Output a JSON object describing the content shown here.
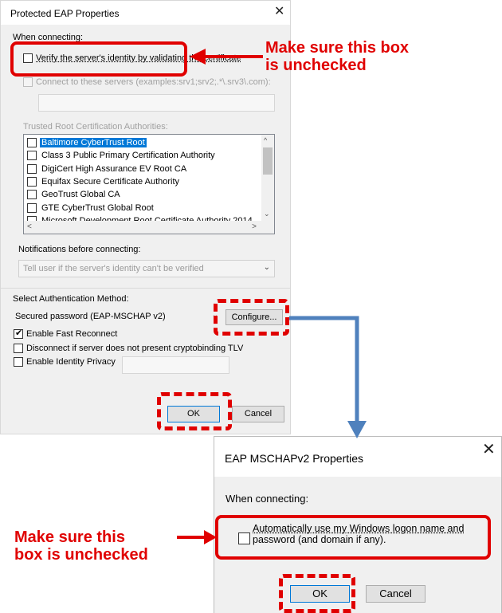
{
  "dialog1": {
    "title": "Protected EAP Properties",
    "when_connecting": "When connecting:",
    "verify_label": "Verify the server's identity by validating the certificate",
    "connect_label": "Connect to these servers (examples:srv1;srv2;.*\\.srv3\\.com):",
    "trusted_label": "Trusted Root Certification Authorities:",
    "cert_list": [
      {
        "name": "Baltimore CyberTrust Root",
        "checked": false,
        "selected": true
      },
      {
        "name": "Class 3 Public Primary Certification Authority",
        "checked": false,
        "selected": false
      },
      {
        "name": "DigiCert High Assurance EV Root CA",
        "checked": false,
        "selected": false
      },
      {
        "name": "Equifax Secure Certificate Authority",
        "checked": false,
        "selected": false
      },
      {
        "name": "GeoTrust Global CA",
        "checked": false,
        "selected": false
      },
      {
        "name": "GTE CyberTrust Global Root",
        "checked": false,
        "selected": false
      },
      {
        "name": "Microsoft Development Root Certificate Authority 2014",
        "checked": false,
        "selected": false
      }
    ],
    "notifications_label": "Notifications before connecting:",
    "notifications_value": "Tell user if the server's identity can't be verified",
    "auth_method_label": "Select Authentication Method:",
    "auth_method_value": "Secured password (EAP-MSCHAP v2)",
    "configure_label": "Configure...",
    "fast_reconnect_label": "Enable Fast Reconnect",
    "fast_reconnect_checked": true,
    "disconnect_label": "Disconnect if server does not present cryptobinding TLV",
    "identity_privacy_label": "Enable Identity Privacy",
    "ok_label": "OK",
    "cancel_label": "Cancel",
    "close_glyph": "✕"
  },
  "dialog2": {
    "title": "EAP MSCHAPv2 Properties",
    "when_connecting": "When connecting:",
    "auto_logon_line1": "Automatically use my Windows logon name and",
    "auto_logon_line2": "password (and domain if any).",
    "ok_label": "OK",
    "cancel_label": "Cancel",
    "close_glyph": "✕"
  },
  "annotations": {
    "top_line1": "Make sure this box",
    "top_line2": "is unchecked",
    "bottom_line1": "Make sure this",
    "bottom_line2": "box is unchecked",
    "highlight_color": "#e00000",
    "flow_arrow_color": "#4f81bd"
  }
}
